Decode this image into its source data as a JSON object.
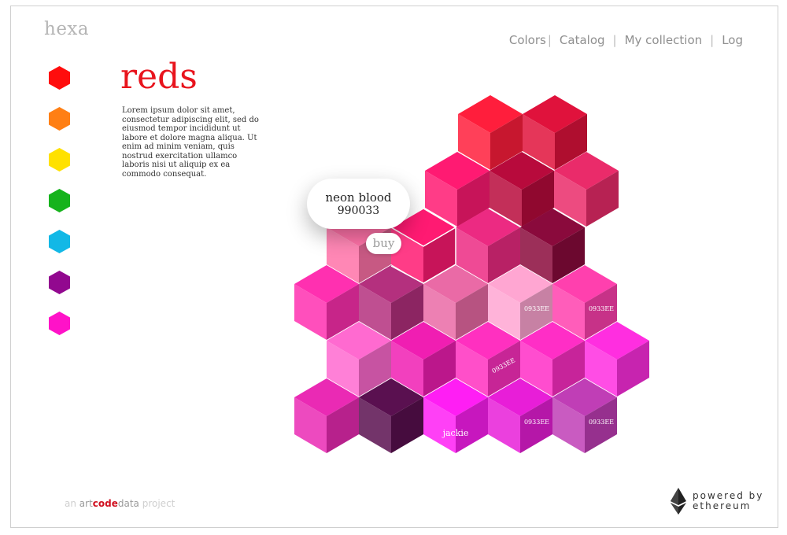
{
  "app": {
    "logo": "hexa"
  },
  "nav": {
    "colors": "Colors",
    "catalog": "Catalog",
    "my_collection": "My collection",
    "log": "Log"
  },
  "palette": [
    {
      "name": "red",
      "color": "#ff0d0d"
    },
    {
      "name": "orange",
      "color": "#ff7f14"
    },
    {
      "name": "yellow",
      "color": "#ffe100"
    },
    {
      "name": "green",
      "color": "#16b31c"
    },
    {
      "name": "cyan",
      "color": "#12b8e6"
    },
    {
      "name": "purple",
      "color": "#92088f"
    },
    {
      "name": "magenta",
      "color": "#ff12c8"
    }
  ],
  "page": {
    "title": "reds",
    "title_color": "#e8141d",
    "description": "Lorem ipsum dolor sit amet, consectetur adipiscing elit, sed do eiusmod tempor incididunt ut labore et dolore magna aliqua. Ut enim ad minim veniam, quis nostrud exercitation ullamco laboris nisi ut aliquip ex ea commodo consequat."
  },
  "tooltip": {
    "name": "neon blood",
    "code": "990033",
    "buy_label": "buy"
  },
  "cubes": [
    {
      "row": 0,
      "col": 0,
      "color": "#ff1e3c"
    },
    {
      "row": 0,
      "col": 1,
      "color": "#e0123c"
    },
    {
      "row": 1,
      "col": 0,
      "color": "#ff1a72"
    },
    {
      "row": 1,
      "col": 1,
      "color": "#b80a3c"
    },
    {
      "row": 1,
      "col": 2,
      "color": "#ea2b6a"
    },
    {
      "row": 2,
      "col": 0,
      "color": "#ff72a8"
    },
    {
      "row": 2,
      "col": 1,
      "color": "#ff1a72",
      "selected": true
    },
    {
      "row": 2,
      "col": 2,
      "color": "#ec2a82"
    },
    {
      "row": 2,
      "col": 3,
      "color": "#8a0a3c"
    },
    {
      "row": 3,
      "col": 0,
      "color": "#ff30b0"
    },
    {
      "row": 3,
      "col": 1,
      "color": "#b4307e"
    },
    {
      "row": 3,
      "col": 2,
      "color": "#ea6aa6"
    },
    {
      "row": 3,
      "col": 3,
      "color": "#ffa6d2",
      "label": "0933EE"
    },
    {
      "row": 3,
      "col": 4,
      "color": "#ff40ae",
      "label": "0933EE"
    },
    {
      "row": 4,
      "col": 0,
      "color": "#ff6ad0"
    },
    {
      "row": 4,
      "col": 1,
      "color": "#f01eb2"
    },
    {
      "row": 4,
      "col": 2,
      "color": "#ff30c0",
      "label": "0933EE",
      "rotated": true
    },
    {
      "row": 4,
      "col": 3,
      "color": "#ff2ec6"
    },
    {
      "row": 4,
      "col": 4,
      "color": "#ff2ee0"
    },
    {
      "row": 5,
      "col": 0,
      "color": "#ea2ab4"
    },
    {
      "row": 5,
      "col": 1,
      "color": "#5a1050"
    },
    {
      "row": 5,
      "col": 2,
      "color": "#ff1ef4",
      "label": "jackie",
      "big": true
    },
    {
      "row": 5,
      "col": 3,
      "color": "#e81ed8",
      "label": "0933EE"
    },
    {
      "row": 5,
      "col": 4,
      "color": "#c03eb6",
      "label": "0933EE"
    }
  ],
  "footer": {
    "an": "an ",
    "art": "art",
    "code": "code",
    "data": "data",
    "project": " project",
    "powered_line1": "powered by",
    "powered_line2": "ethereum"
  }
}
